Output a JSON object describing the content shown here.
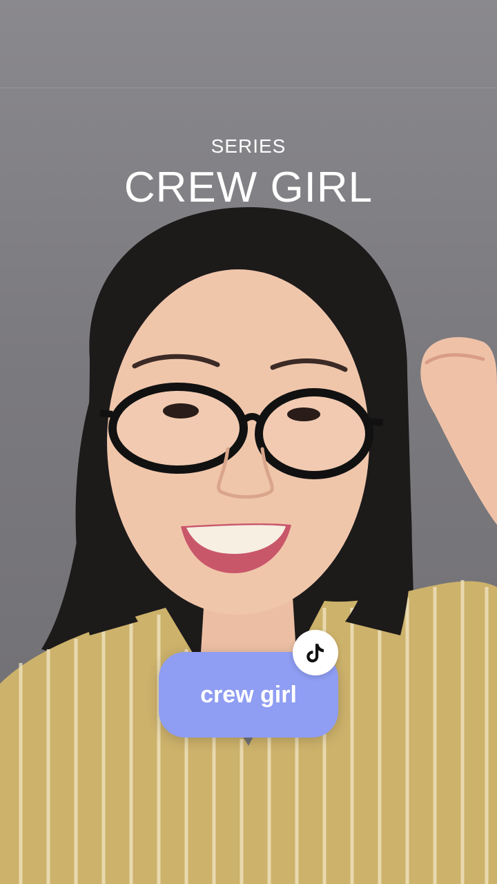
{
  "overlay": {
    "series_label": "SERIES",
    "series_title": "CREW GIRL"
  },
  "series_button": {
    "label": "crew girl",
    "icon": "tiktok-icon"
  },
  "colors": {
    "pill_background": "#8f9df2",
    "text": "#ffffff"
  }
}
